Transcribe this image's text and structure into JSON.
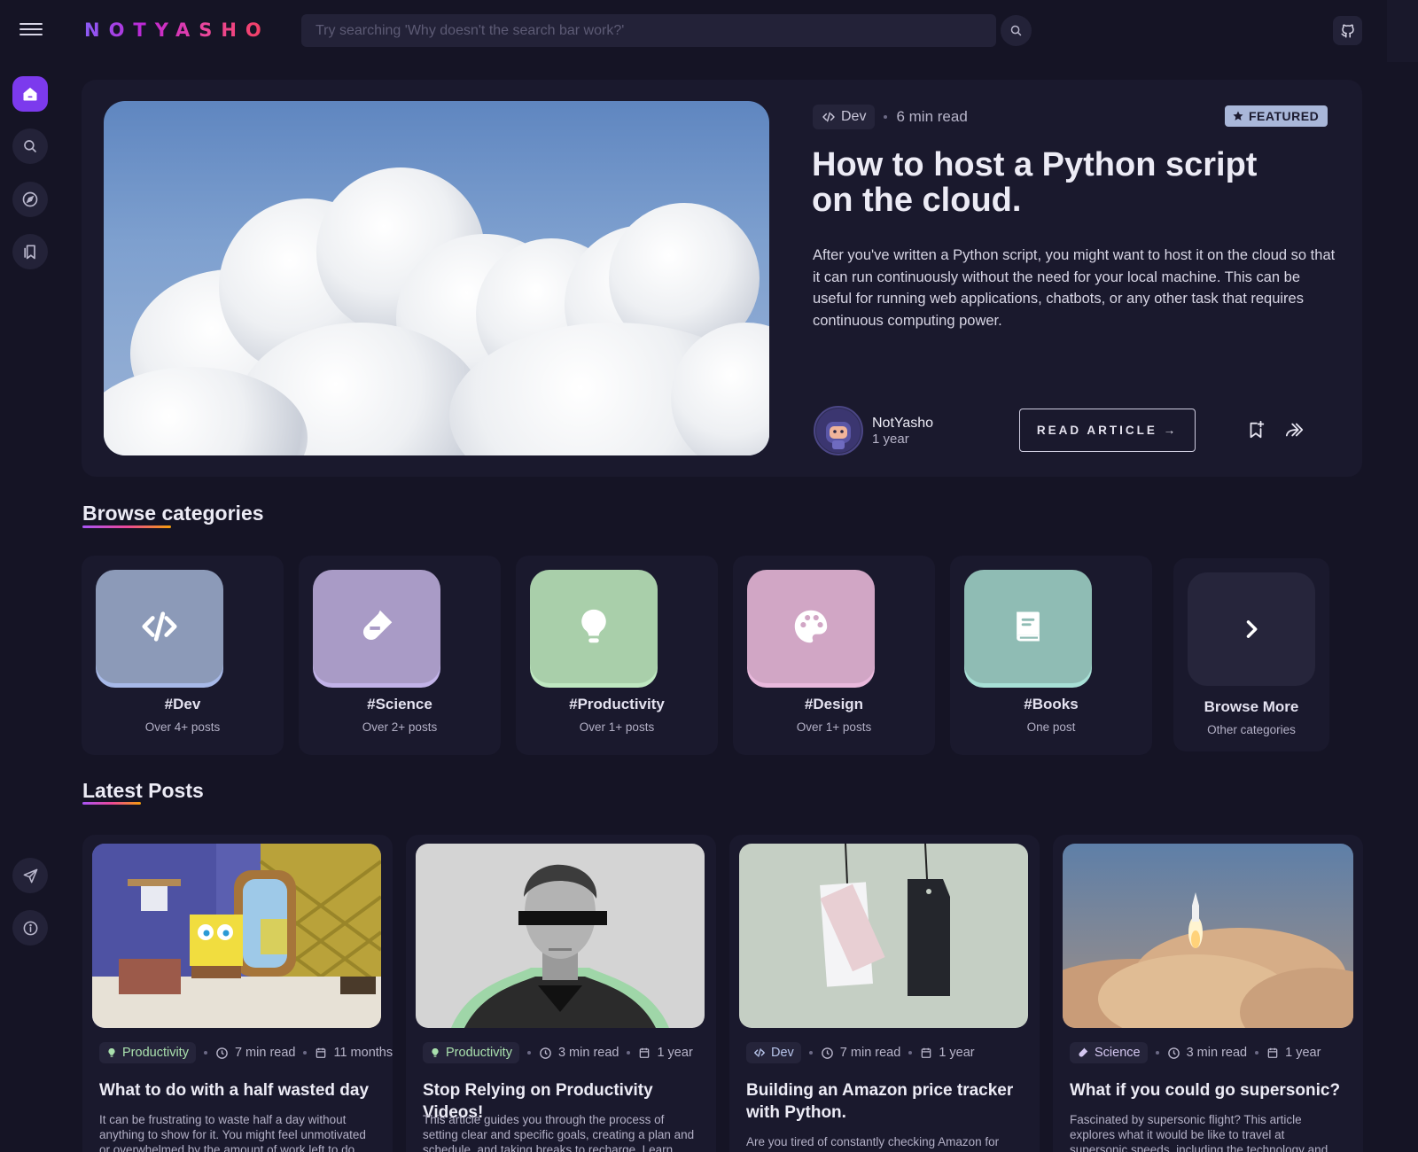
{
  "header": {
    "logo": "NOTYASHO",
    "search_placeholder": "Try searching 'Why doesn't the search bar work?'"
  },
  "sidebar": {
    "items": [
      {
        "icon": "home-icon",
        "active": true
      },
      {
        "icon": "search-icon"
      },
      {
        "icon": "compass-icon"
      },
      {
        "icon": "bookmarks-icon"
      }
    ],
    "bottom_items": [
      {
        "icon": "send-icon"
      },
      {
        "icon": "info-icon"
      }
    ]
  },
  "featured": {
    "category": "Dev",
    "read_time": "6 min read",
    "badge": "FEATURED",
    "title": "How to host a Python script on the cloud.",
    "description": "After you've written a Python script, you might want to host it on the cloud so that it can run continuously without the need for your local machine. This can be useful for running web applications, chatbots, or any other task that requires continuous computing power.",
    "author": "NotYasho",
    "time": "1 year",
    "cta": "READ ARTICLE →"
  },
  "categories_section": {
    "title": "Browse categories",
    "items": [
      {
        "name": "#Dev",
        "count": "Over 4+ posts",
        "color": "#8c9ab8",
        "icon": "code-icon"
      },
      {
        "name": "#Science",
        "count": "Over 2+ posts",
        "color": "#a99bc6",
        "icon": "flask-icon"
      },
      {
        "name": "#Productivity",
        "count": "Over 1+ posts",
        "color": "#a9cfaa",
        "icon": "lightbulb-icon"
      },
      {
        "name": "#Design",
        "count": "Over 1+ posts",
        "color": "#d1a6c5",
        "icon": "palette-icon"
      },
      {
        "name": "#Books",
        "count": "One post",
        "color": "#8fbcb4",
        "icon": "book-icon"
      }
    ],
    "browse_more": {
      "name": "Browse More",
      "sub": "Other categories"
    }
  },
  "latest_section": {
    "title": "Latest Posts",
    "posts": [
      {
        "category": "Productivity",
        "read_time": "7 min read",
        "date": "11 months",
        "title": "What to do with a half wasted day",
        "description": "It can be frustrating to waste half a day without anything to show for it. You might feel unmotivated or overwhelmed by the amount of work left to do. This"
      },
      {
        "category": "Productivity",
        "read_time": "3 min read",
        "date": "1 year",
        "title": "Stop Relying on Productivity Videos!",
        "description": "This article guides you through the process of setting clear and specific goals, creating a plan and schedule, and taking breaks to recharge. Learn how to stop"
      },
      {
        "category": "Dev",
        "read_time": "7 min read",
        "date": "1 year",
        "title": "Building an Amazon price tracker with Python.",
        "description": "Are you tired of constantly checking Amazon for price drops? Build your own tracker with Python and get notified"
      },
      {
        "category": "Science",
        "read_time": "3 min read",
        "date": "1 year",
        "title": "What if you could go supersonic?",
        "description": "Fascinated by supersonic flight? This article explores what it would be like to travel at supersonic speeds, including the technology and engineering behind it."
      }
    ]
  }
}
